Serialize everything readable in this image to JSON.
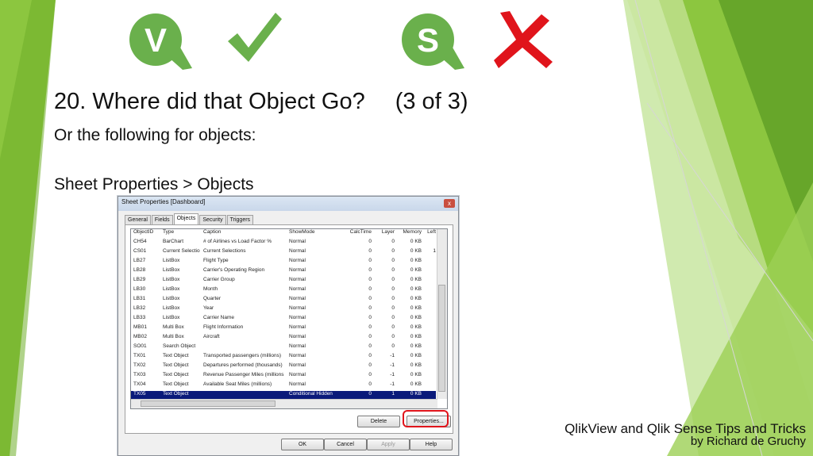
{
  "slide": {
    "title": "20. Where did that Object Go?",
    "title_count": "(3 of 3)",
    "subtitle": "Or the following for objects:",
    "path": "Sheet Properties > Objects",
    "footer_line1": "QlikView and Qlik Sense Tips and Tricks",
    "footer_line2": "by Richard de Gruchy",
    "logos": [
      {
        "letter": "V",
        "icon": "qlikview-logo-icon",
        "mark": "green-checkmark-icon"
      },
      {
        "letter": "S",
        "icon": "qliksense-logo-icon",
        "mark": "red-x-icon"
      }
    ],
    "colors": {
      "green": "#6ab04c",
      "red": "#e0141b",
      "selection": "#0a1a7a"
    }
  },
  "dialog": {
    "title": "Sheet Properties [Dashboard]",
    "close": "x",
    "tabs": [
      "General",
      "Fields",
      "Objects",
      "Security",
      "Triggers"
    ],
    "active_tab": "Objects",
    "columns": [
      "ObjectID",
      "Type",
      "Caption",
      "ShowMode",
      "CalcTime",
      "Layer",
      "Memory",
      "Left"
    ],
    "rows": [
      [
        "CH54",
        "BarChart",
        "# of Airlines vs Load Factor %",
        "Normal",
        "0",
        "0",
        "0 KB",
        ""
      ],
      [
        "CS01",
        "Current Selectio",
        "Current Selections",
        "Normal",
        "0",
        "0",
        "0 KB",
        "1"
      ],
      [
        "LB27",
        "ListBox",
        "Flight Type",
        "Normal",
        "0",
        "0",
        "0 KB",
        ""
      ],
      [
        "LB28",
        "ListBox",
        "Carrier's Operating Region",
        "Normal",
        "0",
        "0",
        "0 KB",
        ""
      ],
      [
        "LB29",
        "ListBox",
        "Carrier Group",
        "Normal",
        "0",
        "0",
        "0 KB",
        ""
      ],
      [
        "LB30",
        "ListBox",
        "Month",
        "Normal",
        "0",
        "0",
        "0 KB",
        ""
      ],
      [
        "LB31",
        "ListBox",
        "Quarter",
        "Normal",
        "0",
        "0",
        "0 KB",
        ""
      ],
      [
        "LB32",
        "ListBox",
        "Year",
        "Normal",
        "0",
        "0",
        "0 KB",
        ""
      ],
      [
        "LB33",
        "ListBox",
        "Carrier Name",
        "Normal",
        "0",
        "0",
        "0 KB",
        ""
      ],
      [
        "MB01",
        "Multi Box",
        "Flight Information",
        "Normal",
        "0",
        "0",
        "0 KB",
        ""
      ],
      [
        "MB02",
        "Multi Box",
        "Aircraft",
        "Normal",
        "0",
        "0",
        "0 KB",
        ""
      ],
      [
        "SO01",
        "Search Object",
        "",
        "Normal",
        "0",
        "0",
        "0 KB",
        ""
      ],
      [
        "TX01",
        "Text Object",
        "Transported passengers (millions)",
        "Normal",
        "0",
        "-1",
        "0 KB",
        ""
      ],
      [
        "TX02",
        "Text Object",
        "Departures performed (thousands)",
        "Normal",
        "0",
        "-1",
        "0 KB",
        ""
      ],
      [
        "TX03",
        "Text Object",
        "Revenue Passenger Miles (millions",
        "Normal",
        "0",
        "-1",
        "0 KB",
        ""
      ],
      [
        "TX04",
        "Text Object",
        "Available Seat Miles (millions)",
        "Normal",
        "0",
        "-1",
        "0 KB",
        ""
      ],
      [
        "TX05",
        "Text Object",
        "",
        "Conditional Hidden",
        "0",
        "1",
        "0 KB",
        ""
      ]
    ],
    "selected_row": 16,
    "buttons": {
      "delete": "Delete",
      "properties": "Properties...",
      "ok": "OK",
      "cancel": "Cancel",
      "apply": "Apply",
      "help": "Help"
    }
  }
}
